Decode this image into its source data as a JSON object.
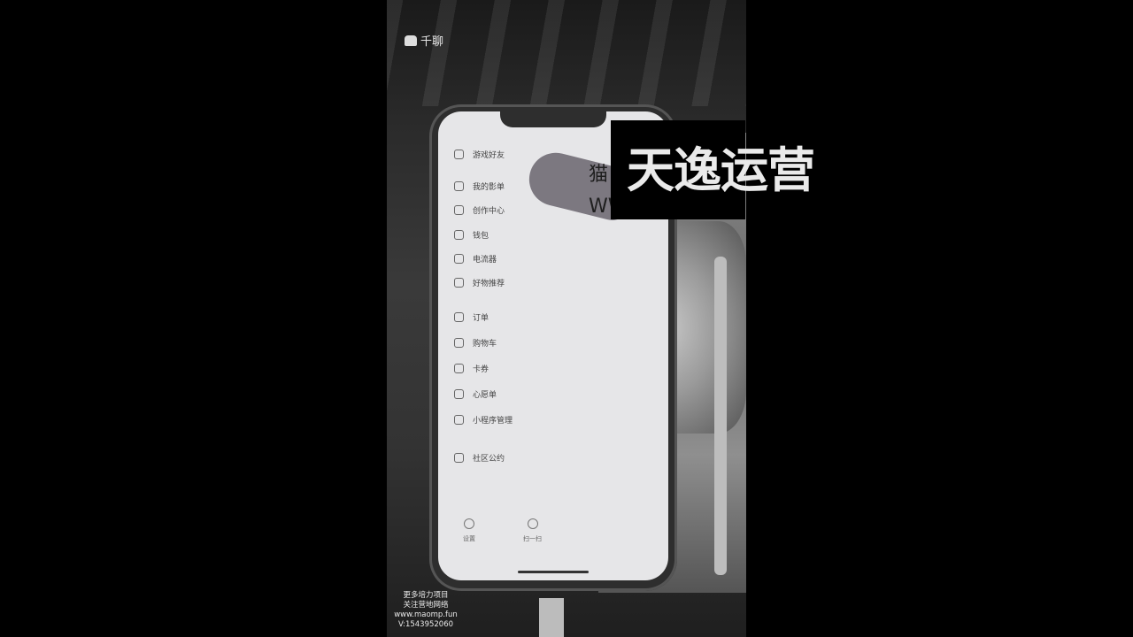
{
  "app": {
    "logo_text": "千聊"
  },
  "menu": {
    "items": [
      {
        "label": "游戏好友",
        "icon": "user-circle-icon"
      },
      {
        "label": "我的影单",
        "icon": "collection-icon"
      },
      {
        "label": "创作中心",
        "icon": "star-icon"
      },
      {
        "label": "钱包",
        "icon": "wallet-icon"
      },
      {
        "label": "电流器",
        "icon": "device-icon"
      },
      {
        "label": "好物推荐",
        "icon": "gift-icon"
      },
      {
        "label": "订单",
        "icon": "order-icon"
      },
      {
        "label": "购物车",
        "icon": "cart-icon"
      },
      {
        "label": "卡券",
        "icon": "coupon-icon"
      },
      {
        "label": "心愿单",
        "icon": "wishlist-icon"
      },
      {
        "label": "小程序管理",
        "icon": "mini-program-icon"
      },
      {
        "label": "社区公约",
        "icon": "community-icon"
      }
    ]
  },
  "bottom": {
    "left_label": "设置",
    "center_label": "扫一扫"
  },
  "overlay": {
    "partial_line1": "猫",
    "partial_line2": "WW",
    "banner": "天逸运营"
  },
  "promo": {
    "line1": "更多培力项目",
    "line2": "www.maomp.fun",
    "line3": "关注营地网络",
    "line4": "V:1543952060"
  }
}
